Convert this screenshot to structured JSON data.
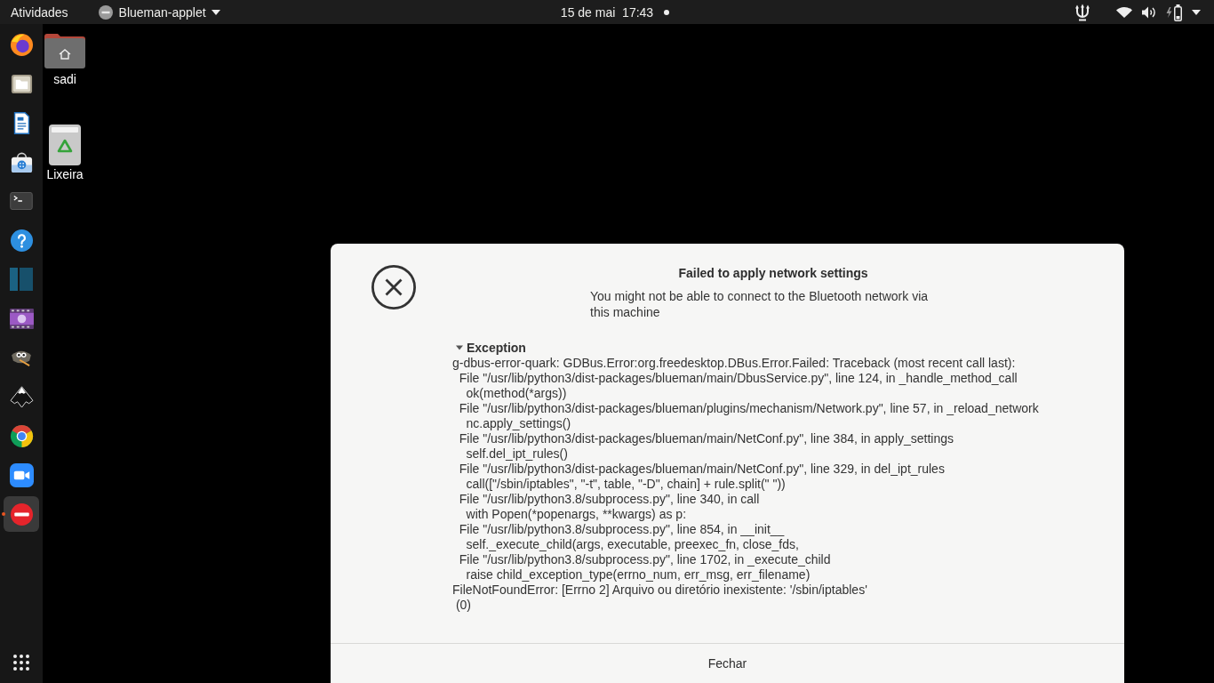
{
  "top_bar": {
    "activities": "Atividades",
    "app_menu": {
      "label": "Blueman-applet"
    },
    "clock": "15 de mai  17:43",
    "notification_dot": true
  },
  "dock": {
    "items": [
      {
        "kind": "fox",
        "selected": false,
        "running": false
      },
      {
        "kind": "folder",
        "selected": false,
        "running": false
      },
      {
        "kind": "document",
        "selected": false,
        "running": false
      },
      {
        "kind": "bag",
        "selected": false,
        "running": false
      },
      {
        "kind": "terminal",
        "selected": false,
        "running": false
      },
      {
        "kind": "help",
        "selected": false,
        "running": false
      },
      {
        "kind": "panel",
        "selected": false,
        "running": false
      },
      {
        "kind": "film",
        "selected": false,
        "running": false
      },
      {
        "kind": "mascot",
        "selected": false,
        "running": false
      },
      {
        "kind": "mountain",
        "selected": false,
        "running": false
      },
      {
        "kind": "wheel",
        "selected": false,
        "running": false
      },
      {
        "kind": "camera",
        "selected": false,
        "running": false
      },
      {
        "kind": "no-entry",
        "selected": true,
        "running": true
      }
    ]
  },
  "desktop_icons": [
    {
      "kind": "home",
      "label": "sadi"
    },
    {
      "kind": "trash",
      "label": "Lixeira"
    }
  ],
  "dialog": {
    "title": "Failed to apply network settings",
    "message": "You might not be able to connect to the Bluetooth network via this machine",
    "expander": {
      "label": "Exception",
      "expanded": true,
      "lines": [
        "g-dbus-error-quark: GDBus.Error:org.freedesktop.DBus.Error.Failed: Traceback (most recent call last):",
        "  File \"/usr/lib/python3/dist-packages/blueman/main/DbusService.py\", line 124, in _handle_method_call",
        "    ok(method(*args))",
        "  File \"/usr/lib/python3/dist-packages/blueman/plugins/mechanism/Network.py\", line 57, in _reload_network",
        "    nc.apply_settings()",
        "  File \"/usr/lib/python3/dist-packages/blueman/main/NetConf.py\", line 384, in apply_settings",
        "    self.del_ipt_rules()",
        "  File \"/usr/lib/python3/dist-packages/blueman/main/NetConf.py\", line 329, in del_ipt_rules",
        "    call([\"/sbin/iptables\", \"-t\", table, \"-D\", chain] + rule.split(\" \"))",
        "  File \"/usr/lib/python3.8/subprocess.py\", line 340, in call",
        "    with Popen(*popenargs, **kwargs) as p:",
        "  File \"/usr/lib/python3.8/subprocess.py\", line 854, in __init__",
        "    self._execute_child(args, executable, preexec_fn, close_fds,",
        "  File \"/usr/lib/python3.8/subprocess.py\", line 1702, in _execute_child",
        "    raise child_exception_type(errno_num, err_msg, err_filename)",
        "FileNotFoundError: [Errno 2] Arquivo ou diretório inexistente: '/sbin/iptables'",
        " (0)"
      ]
    },
    "buttons": [
      "Fechar"
    ]
  }
}
